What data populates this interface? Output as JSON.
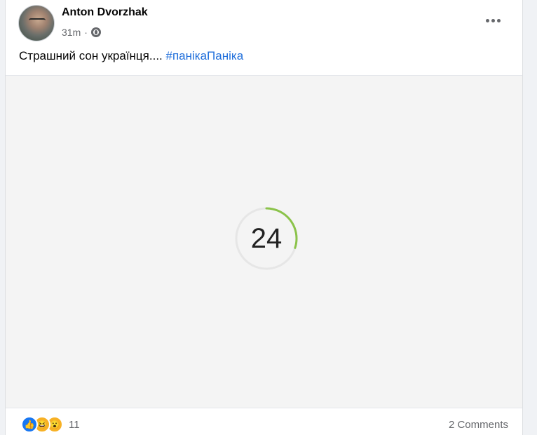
{
  "post": {
    "author": "Anton Dvorzhak",
    "time": "31m",
    "separator": "·",
    "privacy_icon": "globe-icon",
    "text": "Страшний сон українця.... ",
    "hashtag": "#панікаПаніка"
  },
  "media": {
    "countdown_value": "24",
    "countdown_progress": 0.3,
    "colors": {
      "progress": "#8bc34a",
      "track": "#e6e6e6"
    }
  },
  "footer": {
    "reaction_icons": [
      "like-icon",
      "haha-icon",
      "wow-icon"
    ],
    "reaction_count": "11",
    "comments": "2 Comments"
  }
}
